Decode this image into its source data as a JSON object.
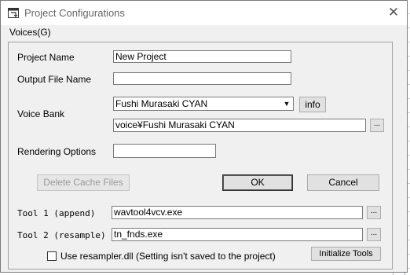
{
  "window": {
    "title": "Project Configurations",
    "close_glyph": "✕"
  },
  "menu": {
    "voices": "Voices(G)"
  },
  "form": {
    "project_name": {
      "label": "Project Name",
      "value": "New Project"
    },
    "output_file": {
      "label": "Output File Name",
      "value": ""
    },
    "voice_bank": {
      "label": "Voice Bank",
      "selected": "Fushi Murasaki CYAN",
      "path": "voice¥Fushi Murasaki CYAN",
      "info_label": "info"
    },
    "rendering": {
      "label": "Rendering Options",
      "value": ""
    },
    "tool1": {
      "label": "Tool 1 (append)",
      "value": "wavtool4vcv.exe"
    },
    "tool2": {
      "label": "Tool 2 (resample)",
      "value": "tn_fnds.exe"
    },
    "resampler_dll": {
      "label": "Use resampler.dll (Setting isn't saved to the project)",
      "checked": false
    }
  },
  "buttons": {
    "delete_cache": "Delete Cache Files",
    "ok": "OK",
    "cancel": "Cancel",
    "initialize_tools": "Initialize Tools",
    "browse": "..."
  },
  "icons": {
    "app": "window-config-icon",
    "close": "close-icon",
    "dropdown": "chevron-down-icon"
  }
}
